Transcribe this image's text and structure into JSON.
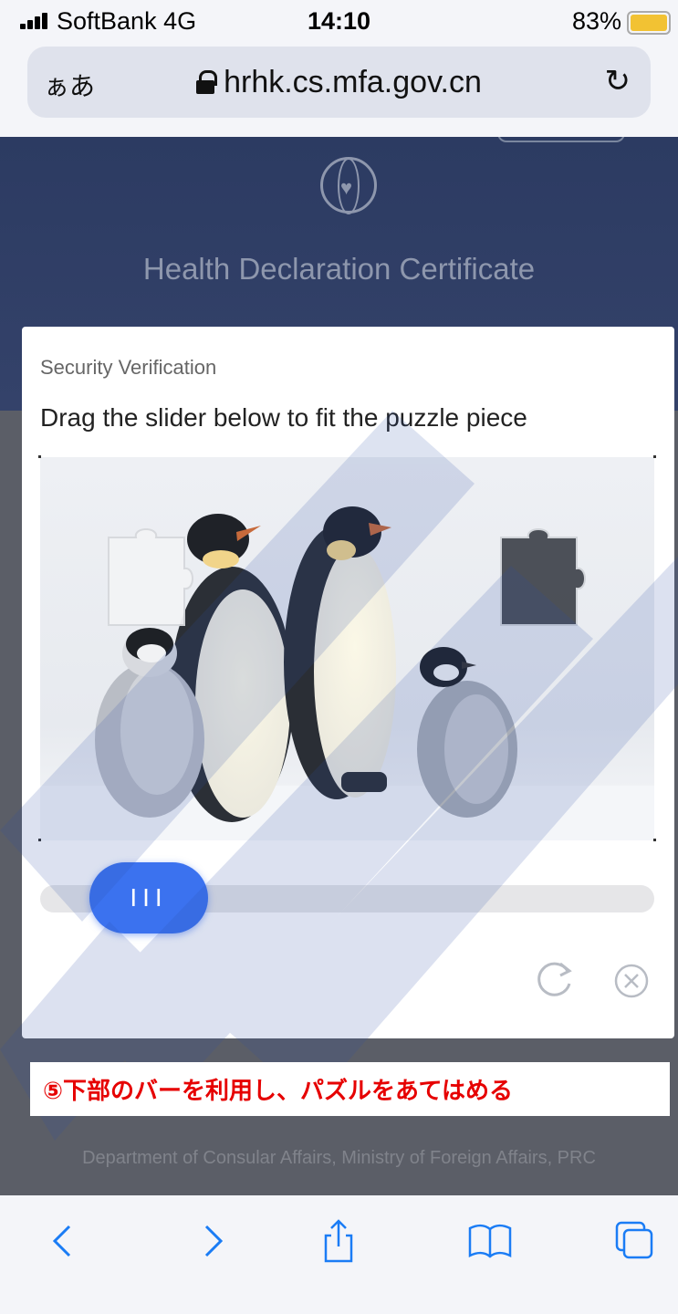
{
  "status_bar": {
    "carrier": "SoftBank  4G",
    "time": "14:10",
    "battery_percent": "83%",
    "battery_level": 0.83,
    "battery_color": "#f2c233"
  },
  "address_bar": {
    "text_size_label": "ぁあ",
    "url": "hrhk.cs.mfa.gov.cn",
    "lock_icon": "lock-icon",
    "reload_icon": "reload-icon"
  },
  "site": {
    "logo_icon": "globe-heart-icon",
    "title": "Health Declaration Certificate",
    "footer": "Department of Consular Affairs, Ministry of Foreign Affairs, PRC"
  },
  "verification": {
    "subtitle": "Security Verification",
    "instruction": "Drag the slider below to fit the puzzle piece",
    "slider_handle_label": "III",
    "slider_accent_color": "#3b72ef",
    "refresh_icon": "refresh-icon",
    "close_icon": "close-circle-icon"
  },
  "caption": {
    "text": "⑤下部のバーを利用し、パズルをあてはめる",
    "color": "#e60000"
  },
  "toolbar": {
    "icons": [
      "back-icon",
      "forward-icon",
      "share-icon",
      "bookmarks-icon",
      "tabs-icon"
    ],
    "accent_color": "#1a7cf5"
  }
}
